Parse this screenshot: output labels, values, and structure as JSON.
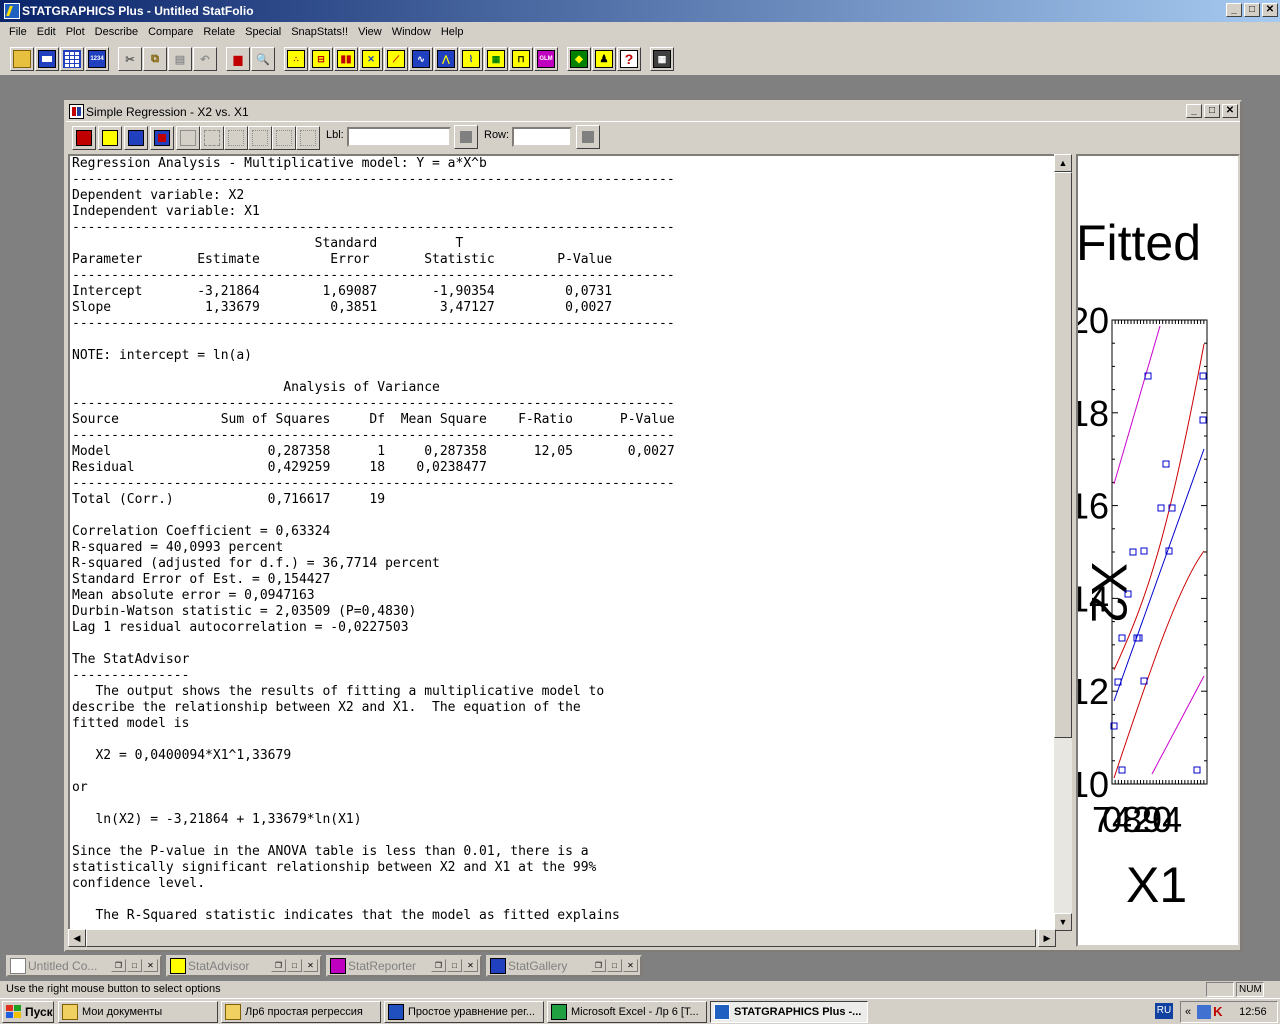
{
  "app": {
    "title": "STATGRAPHICS Plus - Untitled StatFolio",
    "min": "_",
    "max": "□",
    "close": "✕"
  },
  "menu": [
    "File",
    "Edit",
    "Plot",
    "Describe",
    "Compare",
    "Relate",
    "Special",
    "SnapStats!!",
    "View",
    "Window",
    "Help"
  ],
  "child": {
    "title": "Simple Regression - X2 vs. X1",
    "lbl_label": "Lbl:",
    "row_label": "Row:",
    "lbl_value": "",
    "row_value": ""
  },
  "report_lines": [
    "Regression Analysis - Multiplicative model: Y = a*X^b",
    "-----------------------------------------------------------------------------",
    "Dependent variable: X2",
    "Independent variable: X1",
    "-----------------------------------------------------------------------------",
    "                               Standard          T",
    "Parameter       Estimate         Error       Statistic        P-Value",
    "-----------------------------------------------------------------------------",
    "Intercept       -3,21864        1,69087       -1,90354         0,0731",
    "Slope            1,33679         0,3851        3,47127         0,0027",
    "-----------------------------------------------------------------------------",
    "",
    "NOTE: intercept = ln(a)",
    "",
    "                           Analysis of Variance",
    "-----------------------------------------------------------------------------",
    "Source             Sum of Squares     Df  Mean Square    F-Ratio      P-Value",
    "-----------------------------------------------------------------------------",
    "Model                    0,287358      1     0,287358      12,05       0,0027",
    "Residual                 0,429259     18    0,0238477",
    "-----------------------------------------------------------------------------",
    "Total (Corr.)            0,716617     19",
    "",
    "Correlation Coefficient = 0,63324",
    "R-squared = 40,0993 percent",
    "R-squared (adjusted for d.f.) = 36,7714 percent",
    "Standard Error of Est. = 0,154427",
    "Mean absolute error = 0,0947163",
    "Durbin-Watson statistic = 2,03509 (P=0,4830)",
    "Lag 1 residual autocorrelation = -0,0227503",
    "",
    "The StatAdvisor",
    "---------------",
    "   The output shows the results of fitting a multiplicative model to",
    "describe the relationship between X2 and X1.  The equation of the",
    "fitted model is",
    "",
    "   X2 = 0,0400094*X1^1,33679",
    "",
    "or",
    "",
    "   ln(X2) = -3,21864 + 1,33679*ln(X1)",
    "",
    "Since the P-value in the ANOVA table is less than 0.01, there is a",
    "statistically significant relationship between X2 and X1 at the 99%",
    "confidence level.",
    "",
    "   The R-Squared statistic indicates that the model as fitted explains"
  ],
  "chart": {
    "title_fragment": "Fitted",
    "y_axis_label": "X2",
    "y_ticks": [
      "20",
      "18",
      "16",
      "14",
      "12",
      "10"
    ],
    "x_axis_label": "X1",
    "x_tick_overlap": "70482904",
    "colors": {
      "fit": "#0000cc",
      "conf": "#cc0000",
      "pred": "#cc00cc",
      "points": "#0000cc"
    }
  },
  "chart_data": {
    "type": "scatter",
    "title": "Fitted",
    "xlabel": "X1",
    "ylabel": "X2",
    "ylim": [
      10,
      20
    ],
    "y_ticks": [
      10,
      12,
      14,
      16,
      18,
      20
    ]
  },
  "minimized": [
    {
      "title": "Untitled Co..."
    },
    {
      "title": "StatAdvisor"
    },
    {
      "title": "StatReporter"
    },
    {
      "title": "StatGallery"
    }
  ],
  "status": {
    "text": "Use the right mouse button to select options",
    "num": "NUM"
  },
  "taskbar": {
    "start": "Пуск",
    "tasks": [
      "Мои документы",
      "Лр6 простая регрессия",
      "Простое уравнение рег...",
      "Microsoft Excel - Лр 6  [Т...",
      "STATGRAPHICS Plus -..."
    ],
    "lang": "RU",
    "clock": "12:56",
    "chevron": "«"
  }
}
